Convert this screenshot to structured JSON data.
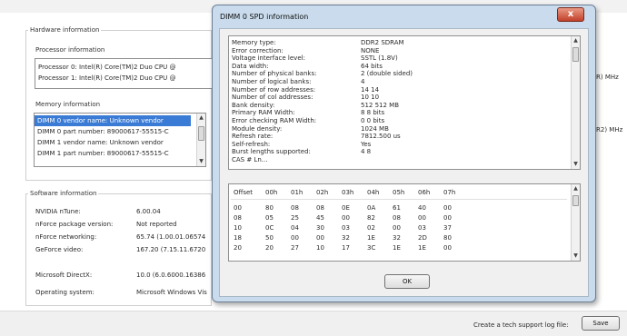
{
  "hardware": {
    "legend": "Hardware information",
    "processor_legend": "Processor information",
    "processors": [
      "Processor 0:  Intel(R) Core(TM)2 Duo CPU       @",
      "Processor 1:  Intel(R) Core(TM)2 Duo CPU       @"
    ],
    "memory_legend": "Memory information",
    "memory_items": [
      "DIMM 0 vendor name: Unknown vendor",
      "DIMM 0 part number: 89000617-55515-C",
      "DIMM 1 vendor name: Unknown vendor",
      "DIMM 1 part number: 89000617-55515-C"
    ],
    "freq1": "R) MHz",
    "freq2": "R2) MHz"
  },
  "software": {
    "legend": "Software information",
    "rows": [
      {
        "label": "NVIDIA nTune:",
        "value": "6.00.04"
      },
      {
        "label": "nForce package version:",
        "value": "Not reported"
      },
      {
        "label": "nForce networking:",
        "value": "65.74 (1.00.01.06574"
      },
      {
        "label": "GeForce video:",
        "value": "167.20 (7.15.11.6720"
      },
      {
        "label": "Microsoft DirectX:",
        "value": "10.0 (6.0.6000.16386"
      },
      {
        "label": "Operating system:",
        "value": "Microsoft Windows Vis"
      }
    ]
  },
  "footer": {
    "log_label": "Create a tech support log file:",
    "save_label": "Save"
  },
  "dialog": {
    "title": "DIMM 0 SPD information",
    "close_label": "x",
    "ok_label": "OK",
    "spd": [
      {
        "k": "Memory type:",
        "v": "DDR2 SDRAM"
      },
      {
        "k": "Error correction:",
        "v": "NONE"
      },
      {
        "k": "Voltage interface level:",
        "v": "SSTL (1.8V)"
      },
      {
        "k": "Data width:",
        "v": "64 bits"
      },
      {
        "k": "Number of physical banks:",
        "v": "2 (double sided)"
      },
      {
        "k": "Number of logical banks:",
        "v": "4"
      },
      {
        "k": "Number of row addresses:",
        "v": "14      14"
      },
      {
        "k": "Number of col addresses:",
        "v": "10      10"
      },
      {
        "k": "Bank density:",
        "v": "512          512 MB"
      },
      {
        "k": "Primary RAM Width:",
        "v": "8        8 bits"
      },
      {
        "k": "Error checking RAM Width:",
        "v": "0        0 bits"
      },
      {
        "k": "Module density:",
        "v": "1024 MB"
      },
      {
        "k": "Refresh rate:",
        "v": "7812.500 us"
      },
      {
        "k": "Self-refresh:",
        "v": "Yes"
      },
      {
        "k": "Burst lengths supported:",
        "v": "               4 8"
      },
      {
        "k": "CAS # Ln...",
        "v": ""
      }
    ],
    "hex_headers": [
      "Offset",
      "00h",
      "01h",
      "02h",
      "03h",
      "04h",
      "05h",
      "06h",
      "07h"
    ],
    "hex_rows": [
      [
        "00",
        "80",
        "08",
        "08",
        "0E",
        "0A",
        "61",
        "40",
        "00"
      ],
      [
        "08",
        "05",
        "25",
        "45",
        "00",
        "82",
        "08",
        "00",
        "00"
      ],
      [
        "10",
        "0C",
        "04",
        "30",
        "03",
        "02",
        "00",
        "03",
        "37"
      ],
      [
        "18",
        "50",
        "00",
        "00",
        "32",
        "1E",
        "32",
        "2D",
        "80"
      ],
      [
        "20",
        "20",
        "27",
        "10",
        "17",
        "3C",
        "1E",
        "1E",
        "00"
      ]
    ]
  },
  "colors": {
    "selection": "#3a7bd5",
    "dialog_frame": "#c9dbec",
    "close_button": "#c2402a"
  }
}
